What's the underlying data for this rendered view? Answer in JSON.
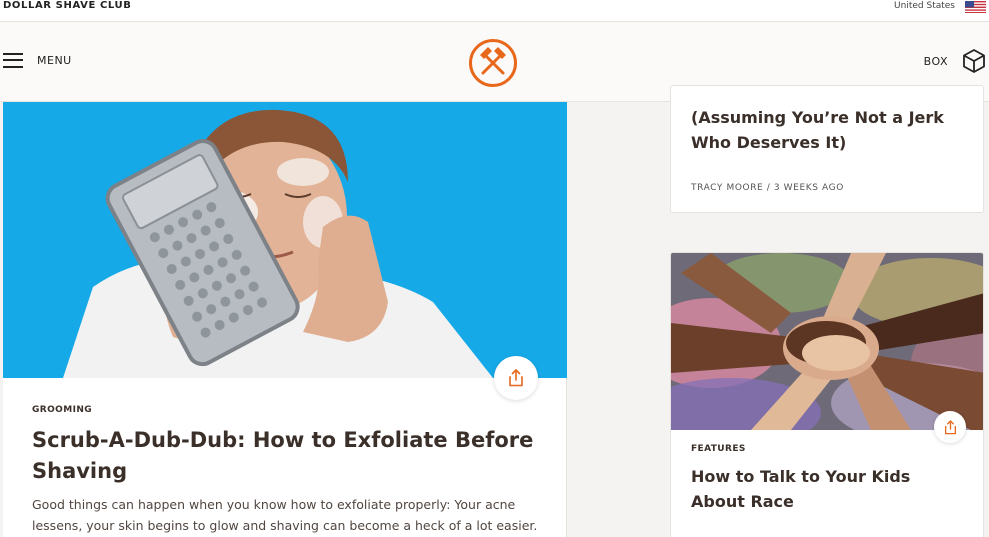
{
  "topbar": {
    "brand": "DOLLAR SHAVE CLUB",
    "country": "United States",
    "flag_icon": "us-flag-icon"
  },
  "header": {
    "menu_label": "MENU",
    "box_label": "BOX",
    "logo_icon": "crossed-hammers-logo",
    "accent_color": "#e8671b"
  },
  "main_article": {
    "category": "GROOMING",
    "title": "Scrub-A-Dub-Dub: How to Exfoliate Before Shaving",
    "excerpt": "Good things can happen when you know how to exfoliate properly: Your acne lessens, your skin begins to glow and shaving can become a heck of a lot easier.",
    "image_bg": "#16a9e8"
  },
  "side_articles": [
    {
      "title": "(Assuming You’re Not a Jerk Who Deserves It)",
      "byline": "TRACY MOORE / 3 WEEKS AGO"
    },
    {
      "category": "FEATURES",
      "title": "How to Talk to Your Kids About Race"
    }
  ]
}
